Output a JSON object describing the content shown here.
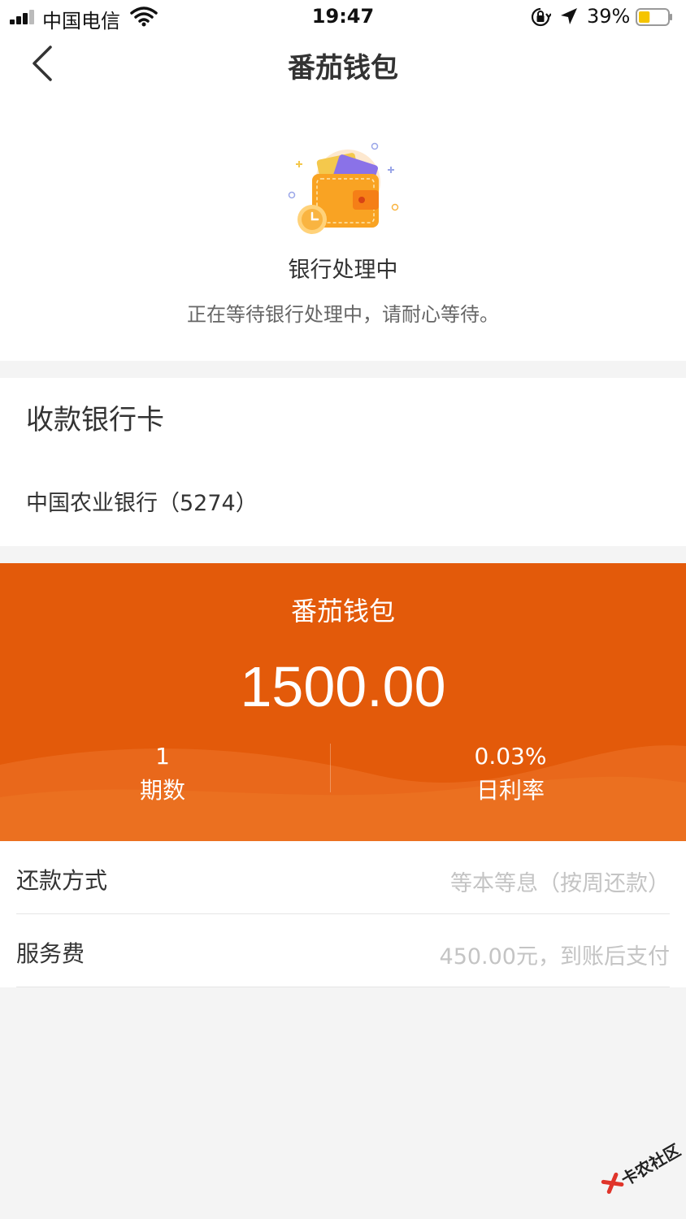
{
  "status_bar": {
    "carrier": "中国电信",
    "time": "19:47",
    "battery_percent": "39%",
    "icons": [
      "signal-icon",
      "wifi-icon",
      "rotation-lock-icon",
      "location-arrow-icon",
      "battery-icon"
    ],
    "battery_level": 0.39,
    "battery_color": "#f5c400"
  },
  "nav": {
    "title": "番茄钱包",
    "back_icon": "chevron-left-icon"
  },
  "status": {
    "illustration": "wallet-clock-illustration",
    "title": "银行处理中",
    "description": "正在等待银行处理中，请耐心等待。"
  },
  "card": {
    "heading": "收款银行卡",
    "bank": "中国农业银行（5274）"
  },
  "loan": {
    "title": "番茄钱包",
    "amount": "1500.00",
    "periods_value": "1",
    "periods_label": "期数",
    "rate_value": "0.03%",
    "rate_label": "日利率",
    "accent_color": "#e35a0a"
  },
  "details": {
    "repay_label": "还款方式",
    "repay_value": "等本等息（按周还款）",
    "fee_label": "服务费",
    "fee_value": "450.00元，到账后支付"
  },
  "watermark": {
    "text": "卡农社区"
  }
}
